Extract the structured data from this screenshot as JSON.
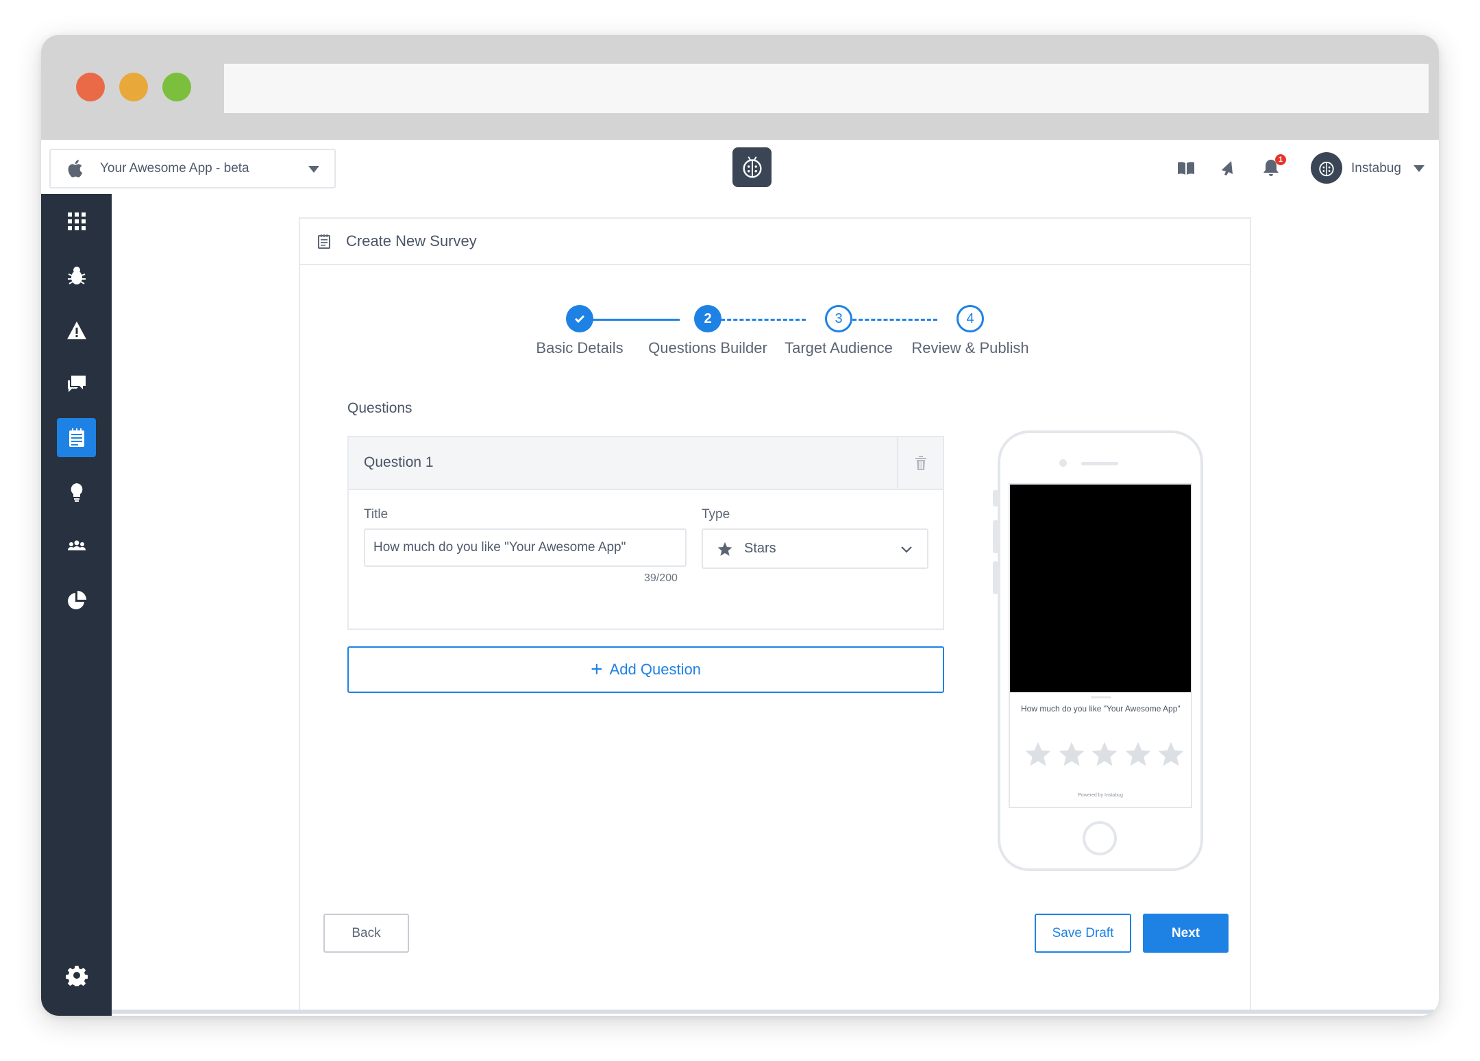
{
  "window": {
    "traffic_lights": [
      "close",
      "minimize",
      "maximize"
    ]
  },
  "header": {
    "app_selector": {
      "value": "Your Awesome App - beta",
      "icon": "apple-icon"
    },
    "logo": "ladybug-logo-icon",
    "icons": [
      "book-icon",
      "megaphone-icon",
      "bell-icon"
    ],
    "notification_count": "1",
    "user_name": "Instabug"
  },
  "sidebar": {
    "items": [
      {
        "name": "dashboard",
        "icon": "grid-icon",
        "active": false
      },
      {
        "name": "bugs",
        "icon": "bug-icon",
        "active": false
      },
      {
        "name": "crashes",
        "icon": "warning-icon",
        "active": false
      },
      {
        "name": "chats",
        "icon": "chat-icon",
        "active": false
      },
      {
        "name": "surveys",
        "icon": "survey-icon",
        "active": true
      },
      {
        "name": "feature-requests",
        "icon": "lightbulb-icon",
        "active": false
      },
      {
        "name": "users",
        "icon": "users-icon",
        "active": false
      },
      {
        "name": "analytics",
        "icon": "pie-chart-icon",
        "active": false
      }
    ],
    "settings_icon": "gear-icon"
  },
  "card": {
    "title": "Create New Survey",
    "steps": [
      {
        "number": "",
        "label": "Basic Details",
        "state": "done"
      },
      {
        "number": "2",
        "label": "Questions Builder",
        "state": "current"
      },
      {
        "number": "3",
        "label": "Target Audience",
        "state": "upcoming"
      },
      {
        "number": "4",
        "label": "Review & Publish",
        "state": "upcoming"
      }
    ],
    "section_title": "Questions",
    "question": {
      "heading": "Question 1",
      "title_label": "Title",
      "title_value": "How much do you like \"Your Awesome App\"",
      "char_count": "39/200",
      "type_label": "Type",
      "type_value": "Stars"
    },
    "add_question_label": "Add Question",
    "preview": {
      "question_text": "How much do you like \"Your Awesome App\"",
      "star_count": 5,
      "powered_by": "Powered by Instabug"
    },
    "buttons": {
      "back": "Back",
      "save_draft": "Save Draft",
      "next": "Next"
    }
  },
  "colors": {
    "accent": "#1e82e4",
    "sidebar": "#28313f",
    "badge": "#e5352c"
  }
}
